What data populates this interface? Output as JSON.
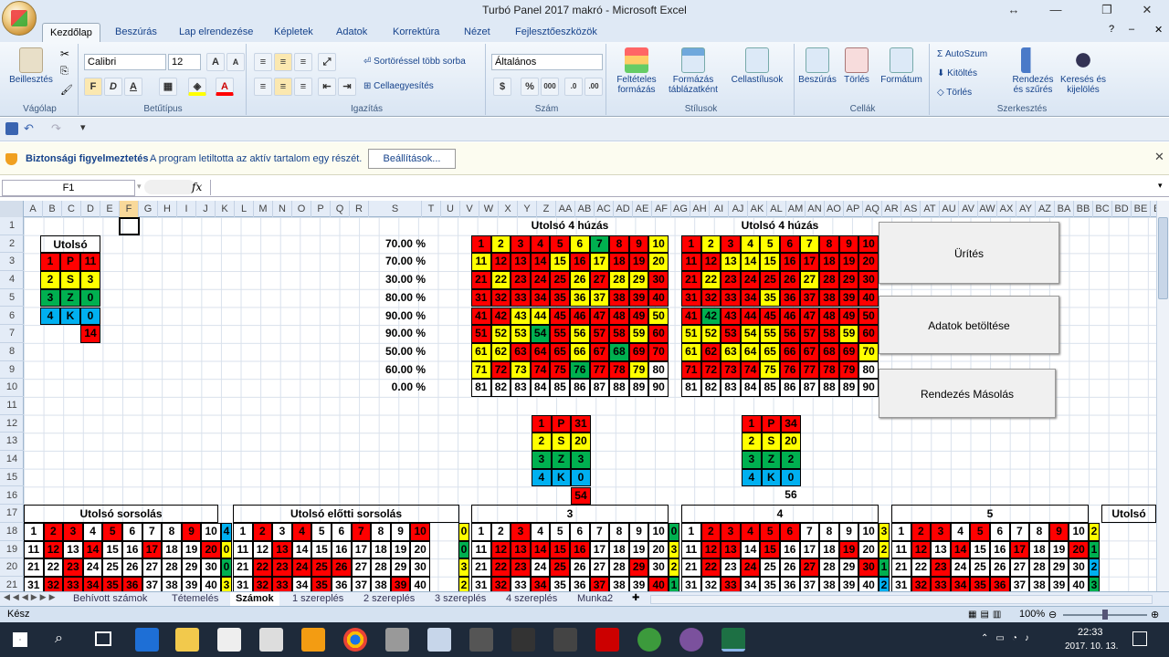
{
  "window": {
    "title": "Turbó Panel 2017 makró  -  Microsoft Excel"
  },
  "tabs": [
    "Kezdőlap",
    "Beszúrás",
    "Lap elrendezése",
    "Képletek",
    "Adatok",
    "Korrektúra",
    "Nézet",
    "Fejlesztőeszközök"
  ],
  "ribbon": {
    "groups": [
      "Vágólap",
      "Betűtípus",
      "Igazítás",
      "Szám",
      "Stílusok",
      "Cellák",
      "Szerkesztés"
    ],
    "paste": "Beillesztés",
    "font": "Calibri",
    "size": "12",
    "bold": "F",
    "italic": "D",
    "underline": "A",
    "wrap": "Sortöréssel több sorba",
    "merge": "Cellaegyesítés",
    "numformat": "Általános",
    "condfmt": "Feltételes formázás",
    "tablefmt": "Formázás táblázatként",
    "cellstyles": "Cellastílusok",
    "insert": "Beszúrás",
    "delete": "Törlés",
    "format": "Formátum",
    "autosum": "AutoSzum",
    "fill": "Kitöltés",
    "clear": "Törlés",
    "sort": "Rendezés és szűrés",
    "find": "Keresés és kijelölés"
  },
  "security": {
    "title": "Biztonsági figyelmeztetés",
    "text": "A program letiltotta az aktív tartalom egy részét.",
    "button": "Beállítások..."
  },
  "formula": {
    "namebox": "F1",
    "fx": "fx"
  },
  "columns": [
    "A",
    "B",
    "C",
    "D",
    "E",
    "F",
    "G",
    "H",
    "I",
    "J",
    "K",
    "L",
    "M",
    "N",
    "O",
    "P",
    "Q",
    "R",
    "S",
    "T",
    "U",
    "V",
    "W",
    "X",
    "Y",
    "Z",
    "AA",
    "AB",
    "AC",
    "AD",
    "AE",
    "AF",
    "AG",
    "AH",
    "AI",
    "AJ",
    "AK",
    "AL",
    "AM",
    "AN",
    "AO",
    "AP",
    "AQ",
    "AR",
    "AS",
    "AT",
    "AU",
    "AV",
    "AW",
    "AX",
    "AY",
    "AZ",
    "BA",
    "BB",
    "BC",
    "BD",
    "BE",
    "BF",
    "BG"
  ],
  "rows": [
    "1",
    "2",
    "3",
    "4",
    "5",
    "6",
    "7",
    "8",
    "9",
    "10",
    "11",
    "12",
    "13",
    "14",
    "15",
    "16",
    "17",
    "18",
    "19",
    "20",
    "21"
  ],
  "sheet": {
    "utolso_label": "Utolsó",
    "legend": [
      [
        "1",
        "P",
        "11"
      ],
      [
        "2",
        "S",
        "3"
      ],
      [
        "3",
        "Z",
        "0"
      ],
      [
        "4",
        "K",
        "0"
      ]
    ],
    "legend_extra": "14",
    "percents": [
      "70.00 %",
      "70.00 %",
      "30.00 %",
      "80.00 %",
      "90.00 %",
      "90.00 %",
      "50.00 %",
      "60.00 %",
      "0.00 %"
    ],
    "grid1_title": "Utolsó 4 húzás",
    "grid2_title": "Utolsó 4 húzás",
    "grid1_colors": "RYRRRYGRRYYRRRYRYRRYRYRRRYRYYRRRRRRYYRRRRRYYRRRRRYRYYGRYRRYRYYRRRYRGRRYRYRRGRRY",
    "grid2_colors": "RYRYYRYRRRRRYYYRRRRRRYRRRRYRRRRRRRYRRRRRRGRRRRRRRRYYRYYRRRYRYRYYYRRRRYRRRRYRRRR",
    "sum1": [
      [
        "1",
        "P",
        "31"
      ],
      [
        "2",
        "S",
        "20"
      ],
      [
        "3",
        "Z",
        "3"
      ],
      [
        "4",
        "K",
        "0"
      ]
    ],
    "sum1_total": "54",
    "sum2": [
      [
        "1",
        "P",
        "34"
      ],
      [
        "2",
        "S",
        "20"
      ],
      [
        "3",
        "Z",
        "2"
      ],
      [
        "4",
        "K",
        "0"
      ]
    ],
    "sum2_total": "56",
    "buttons": [
      "Ürítés",
      "Adatok betöltése",
      "Rendezés Másolás"
    ],
    "bottom_titles": [
      "Utolsó sorsolás",
      "Utolsó előtti sorsolás",
      "3",
      "4",
      "5",
      "Utolsó"
    ],
    "row18": [
      "1",
      "2",
      "3",
      "4",
      "5",
      "6",
      "7",
      "8",
      "9",
      "10"
    ],
    "row19": [
      "11",
      "12",
      "13",
      "14",
      "15",
      "16",
      "17",
      "18",
      "19",
      "20"
    ],
    "row20": [
      "21",
      "22",
      "23",
      "24",
      "25",
      "26",
      "27",
      "28",
      "29",
      "30"
    ],
    "row21": [
      "31",
      "32",
      "33",
      "34",
      "35",
      "36",
      "37",
      "38",
      "39",
      "40"
    ],
    "side_digits": [
      "4",
      "0",
      "0",
      "3",
      "2",
      "1",
      "2",
      "3"
    ]
  },
  "sheet_tabs": [
    "Behívott számok",
    "Tétemelés",
    "Számok",
    "1 szereplés",
    "2 szereplés",
    "3 szereplés",
    "4 szereplés",
    "Munka2"
  ],
  "status": {
    "ready": "Kész",
    "zoom": "100%"
  },
  "clock": {
    "time": "22:33",
    "date": "2017. 10. 13."
  },
  "colors": {
    "red": "#ff0000",
    "yellow": "#ffff00",
    "green": "#00b050",
    "blue": "#00b0f0"
  }
}
